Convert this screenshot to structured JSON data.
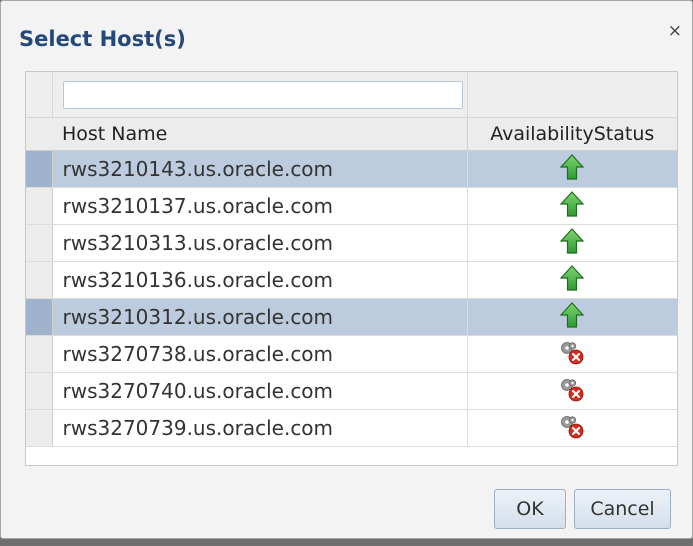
{
  "dialog": {
    "title": "Select Host(s)",
    "close_glyph": "×"
  },
  "table": {
    "filter": {
      "value": "",
      "placeholder": ""
    },
    "columns": {
      "host_name": "Host Name",
      "availability_status": "AvailabilityStatus"
    },
    "rows": [
      {
        "host": "rws3210143.us.oracle.com",
        "status": "up",
        "status_icon": "green-up-arrow-icon",
        "selected": true
      },
      {
        "host": "rws3210137.us.oracle.com",
        "status": "up",
        "status_icon": "green-up-arrow-icon",
        "selected": false
      },
      {
        "host": "rws3210313.us.oracle.com",
        "status": "up",
        "status_icon": "green-up-arrow-icon",
        "selected": false
      },
      {
        "host": "rws3210136.us.oracle.com",
        "status": "up",
        "status_icon": "green-up-arrow-icon",
        "selected": false
      },
      {
        "host": "rws3210312.us.oracle.com",
        "status": "up",
        "status_icon": "green-up-arrow-icon",
        "selected": true
      },
      {
        "host": "rws3270738.us.oracle.com",
        "status": "agent-unreachable",
        "status_icon": "gear-error-icon",
        "selected": false
      },
      {
        "host": "rws3270740.us.oracle.com",
        "status": "agent-unreachable",
        "status_icon": "gear-error-icon",
        "selected": false
      },
      {
        "host": "rws3270739.us.oracle.com",
        "status": "agent-unreachable",
        "status_icon": "gear-error-icon",
        "selected": false
      }
    ]
  },
  "buttons": {
    "ok": "OK",
    "cancel": "Cancel"
  },
  "colors": {
    "title": "#24487a",
    "selected_row": "#bccbdd",
    "status_up": "#3cb44a",
    "status_error": "#d62a1f"
  }
}
